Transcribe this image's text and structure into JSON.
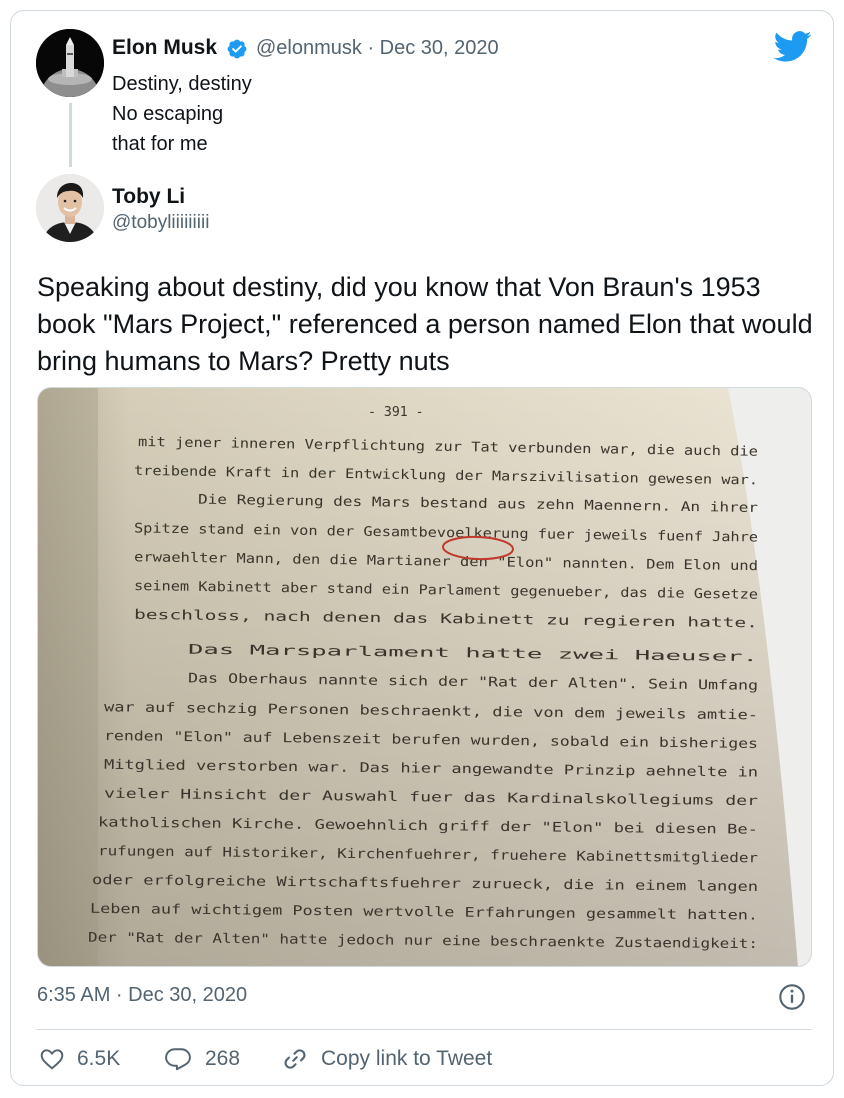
{
  "quoted_tweet": {
    "author_name": "Elon Musk",
    "handle_date": "@elonmusk · Dec 30, 2020",
    "lines": [
      "Destiny, destiny",
      "No escaping",
      "that for me"
    ]
  },
  "tweet": {
    "author_name": "Toby Li",
    "handle": "@tobyliiiiiiiii",
    "text": "Speaking about destiny, did you know that Von Braun's 1953 book \"Mars Project,\" referenced a person named Elon that would bring humans to Mars? Pretty nuts",
    "timestamp": "6:35 AM · Dec 30, 2020"
  },
  "photo_text": {
    "page_number": "- 391 -",
    "lines": [
      "mit jener inneren Verpflichtung zur Tat verbunden war, die auch die",
      "treibende Kraft in der Entwicklung der Marszivilisation gewesen war.",
      "Die Regierung des Mars bestand aus zehn Maennern.  An ihrer",
      "Spitze stand ein von der Gesamtbevoelkerung fuer jeweils fuenf Jahre",
      "erwaehlter Mann, den die Martianer den \"Elon\" nannten.  Dem Elon und",
      "seinem Kabinett aber stand ein Parlament gegenueber, das die Gesetze",
      "beschloss, nach denen das Kabinett zu regieren hatte.",
      "Das Marsparlament hatte zwei Haeuser.",
      "Das Oberhaus nannte sich der \"Rat der Alten\".  Sein Umfang",
      "war auf  sechzig Personen beschraenkt, die von dem jeweils amtie-",
      "renden \"Elon\" auf Lebenszeit berufen wurden, sobald ein bisheriges",
      "Mitglied verstorben war.  Das hier angewandte Prinzip aehnelte in",
      "vieler Hinsicht der Auswahl fuer das Kardinalskollegiums der",
      "katholischen Kirche.  Gewoehnlich griff der \"Elon\" bei diesen Be-",
      "rufungen auf Historiker, Kirchenfuehrer, fruehere Kabinettsmitglieder",
      "oder erfolgreiche Wirtschaftsfuehrer zurueck, die in einem langen",
      "Leben auf wichtigem Posten wertvolle Erfahrungen gesammelt hatten.",
      "Der \"Rat der Alten\" hatte jedoch nur eine beschraenkte Zustaendigkeit:"
    ]
  },
  "actions": {
    "likes": "6.5K",
    "replies": "268",
    "copy_link": "Copy link to Tweet"
  },
  "colors": {
    "twitter_blue": "#1d9bf0",
    "text_primary": "#0f1419",
    "text_secondary": "#536471",
    "border": "#cfd9de",
    "circle_red": "#c0392b"
  },
  "icons": {
    "logo": "twitter-bird-icon",
    "verified": "verified-badge-icon",
    "info": "info-icon",
    "like": "heart-icon",
    "reply": "reply-bubble-icon",
    "link": "link-icon"
  }
}
